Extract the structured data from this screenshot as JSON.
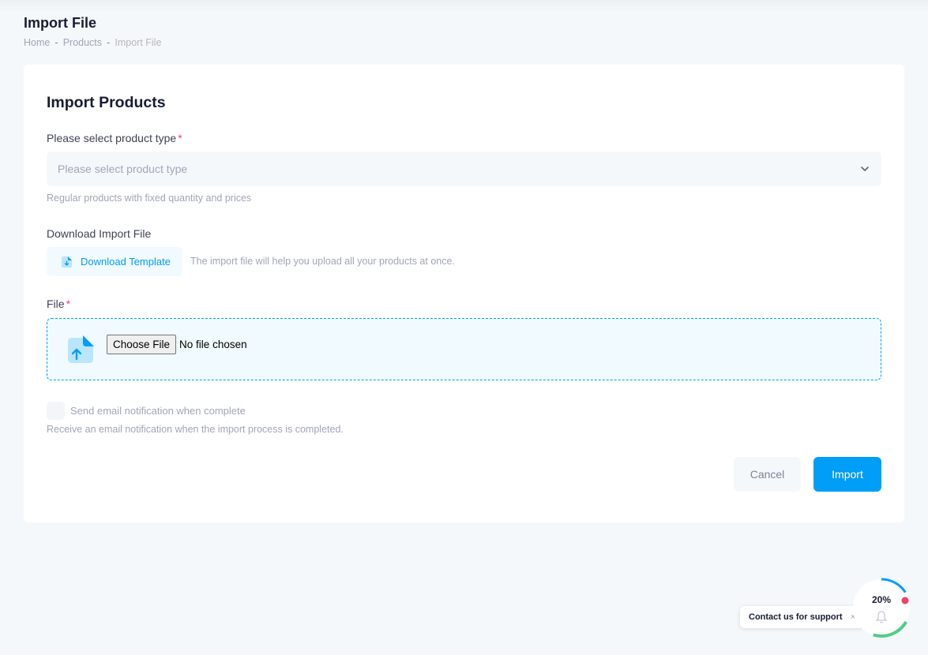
{
  "header": {
    "title": "Import File",
    "breadcrumb": [
      "Home",
      "Products",
      "Import File"
    ],
    "separator": "-"
  },
  "form": {
    "title": "Import Products",
    "product_type": {
      "label": "Please select product type",
      "required_mark": "*",
      "placeholder": "Please select product type",
      "hint": "Regular products with fixed quantity and prices"
    },
    "download": {
      "label": "Download Import File",
      "button_label": "Download Template",
      "note": "The import file will help you upload all your products at once."
    },
    "file": {
      "label": "File",
      "required_mark": "*",
      "choose_button": "Choose File",
      "status": "No file chosen"
    },
    "email_notification": {
      "label": "Send email notification when complete",
      "hint": "Receive an email notification when the import process is completed.",
      "checked": false
    },
    "actions": {
      "cancel_label": "Cancel",
      "import_label": "Import"
    }
  },
  "support": {
    "label": "Contact us for support",
    "close": "×",
    "progress_text": "20%",
    "progress_value": 0.2
  },
  "colors": {
    "primary": "#009ef7",
    "danger": "#f1416c",
    "success": "#50cd89",
    "background": "#f5f8fa"
  },
  "icons": [
    "chevron-down-icon",
    "download-file-icon",
    "upload-file-icon",
    "bell-icon",
    "close-icon"
  ]
}
